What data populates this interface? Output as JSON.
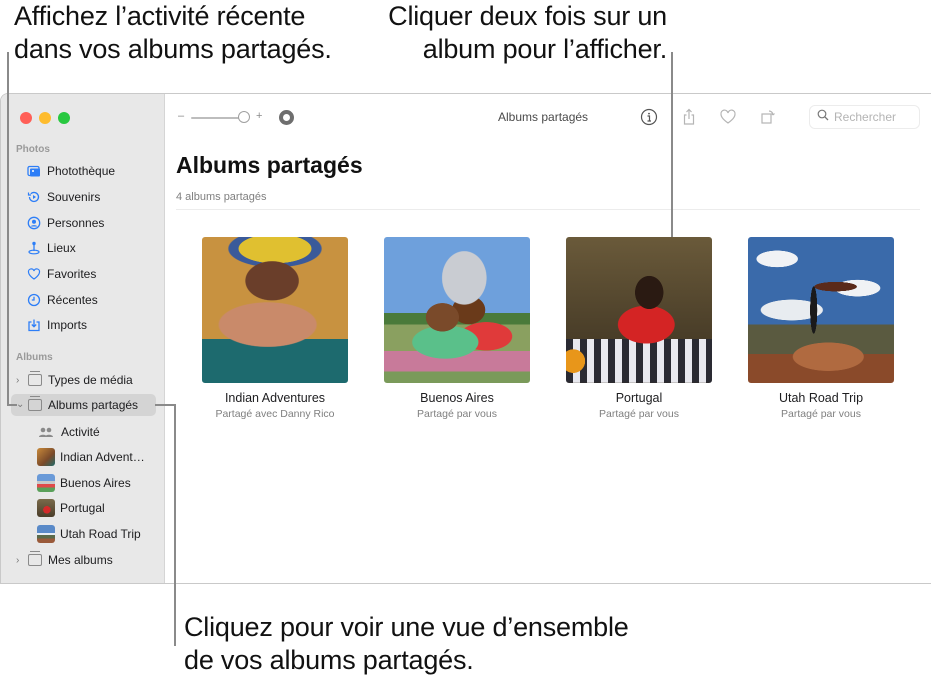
{
  "callouts": {
    "top_left": [
      "Affichez l’activité récente",
      "dans vos albums partagés."
    ],
    "top_right": [
      "Cliquer deux fois sur un",
      "album pour l’afficher."
    ],
    "bottom": [
      "Cliquez pour voir une vue d’ensemble",
      "de vos albums partagés."
    ]
  },
  "window": {
    "traffic_lights": [
      "close",
      "minimize",
      "zoom"
    ]
  },
  "sidebar": {
    "photos_section": "Photos",
    "photos_items": [
      {
        "label": "Photothèque",
        "icon": "photo-library-icon"
      },
      {
        "label": "Souvenirs",
        "icon": "memories-icon"
      },
      {
        "label": "Personnes",
        "icon": "people-icon"
      },
      {
        "label": "Lieux",
        "icon": "places-icon"
      },
      {
        "label": "Favorites",
        "icon": "heart-icon"
      },
      {
        "label": "Récentes",
        "icon": "clock-icon"
      },
      {
        "label": "Imports",
        "icon": "import-icon"
      }
    ],
    "albums_section": "Albums",
    "albums_items": [
      {
        "label": "Types de média",
        "expanded": false
      },
      {
        "label": "Albums partagés",
        "expanded": true,
        "selected": true
      },
      {
        "label": "Mes albums",
        "expanded": false
      }
    ],
    "shared_children": [
      {
        "label": "Activité",
        "icon": "people-icon"
      },
      {
        "label": "Indian Advent…",
        "icon": "album-thumbnail"
      },
      {
        "label": "Buenos Aires",
        "icon": "album-thumbnail"
      },
      {
        "label": "Portugal",
        "icon": "album-thumbnail"
      },
      {
        "label": "Utah Road Trip",
        "icon": "album-thumbnail"
      }
    ]
  },
  "toolbar": {
    "zoom_minus": "–",
    "zoom_plus": "+",
    "title": "Albums partagés",
    "search_placeholder": "Rechercher",
    "icons": [
      "info-icon",
      "share-icon",
      "heart-icon",
      "rotate-icon"
    ]
  },
  "main": {
    "title": "Albums partagés",
    "subtitle": "4 albums partagés",
    "albums": [
      {
        "name": "Indian Adventures",
        "sub": "Partagé avec Danny Rico"
      },
      {
        "name": "Buenos Aires",
        "sub": "Partagé par vous"
      },
      {
        "name": "Portugal",
        "sub": "Partagé par vous"
      },
      {
        "name": "Utah Road Trip",
        "sub": "Partagé par vous"
      }
    ]
  },
  "colors": {
    "accent": "#2d7ef7",
    "sidebar_bg": "#e8e8e8",
    "selection": "#d4d4d4"
  }
}
